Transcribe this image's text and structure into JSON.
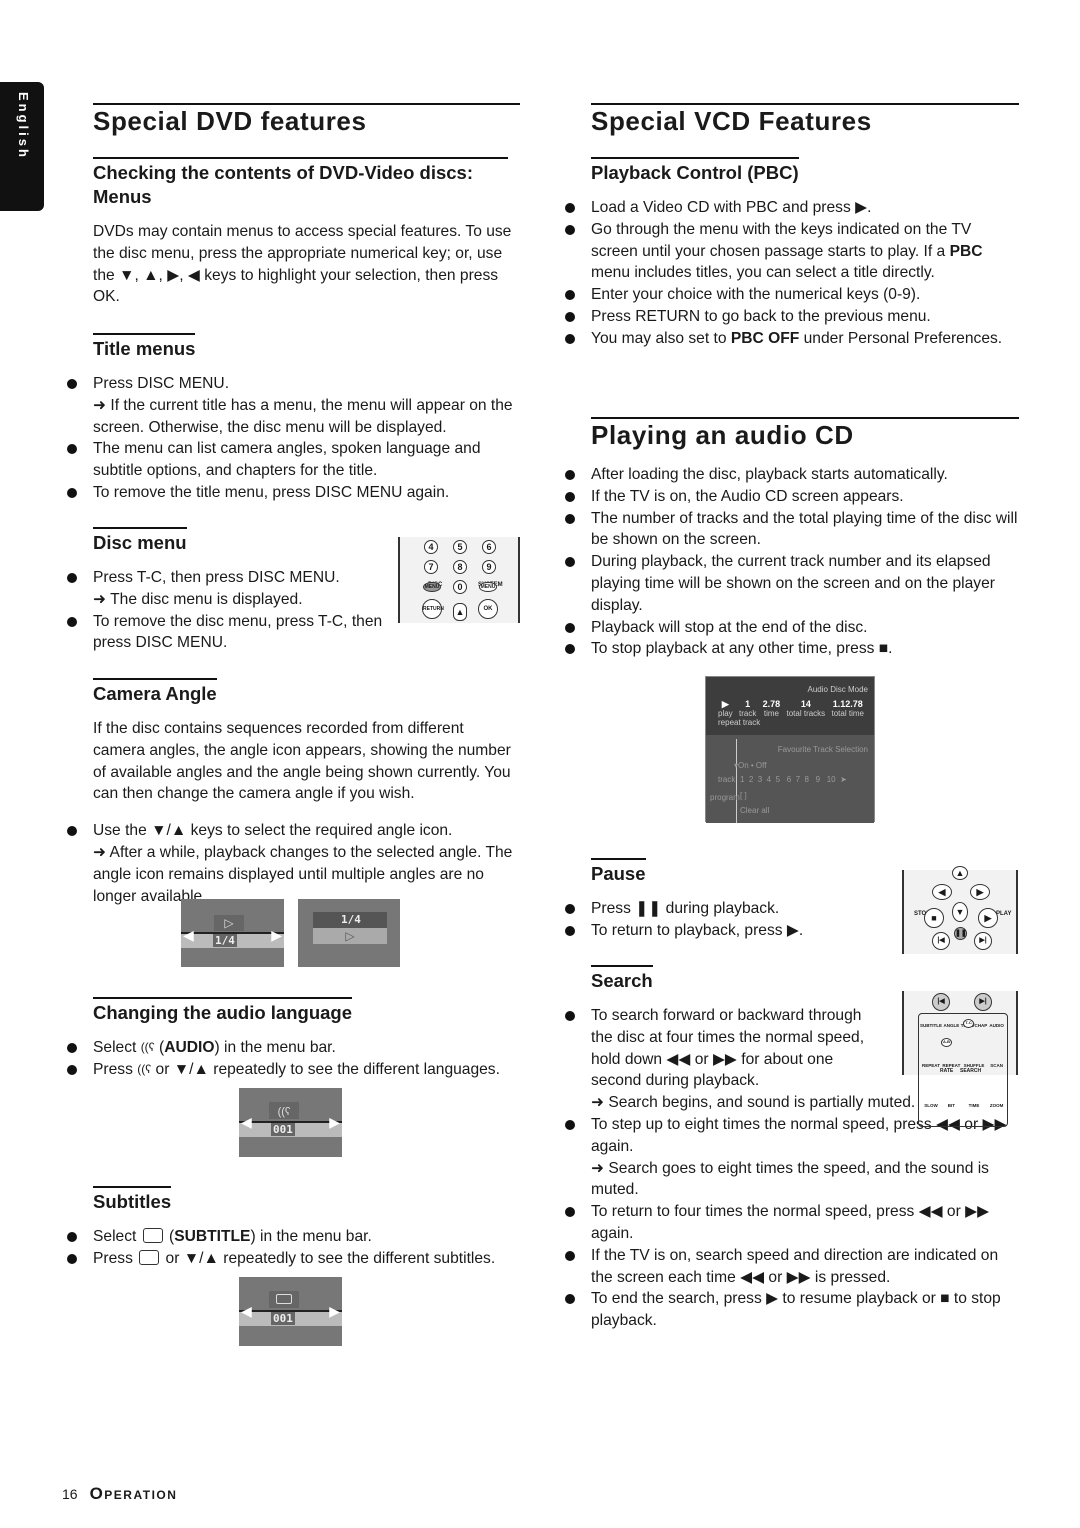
{
  "side_tab": "English",
  "footer": {
    "page_number": "16",
    "section": "Operation"
  },
  "left": [
    {
      "kind": "h1",
      "title": "Special DVD features"
    },
    {
      "kind": "h2",
      "title": "Checking the contents of DVD-Video discs: Menus",
      "full": true,
      "blocks": [
        {
          "type": "p",
          "text": "DVDs may contain menus to access special features. To use the disc menu, press the appropriate numerical key; or, use the ▼, ▲, ▶, ◀ keys to highlight your selection, then press OK."
        }
      ]
    },
    {
      "kind": "h2",
      "title": "Title menus",
      "blocks": [
        {
          "type": "bullet",
          "text": "Press DISC MENU."
        },
        {
          "type": "note",
          "text": "➜ If the current title has a menu, the menu will appear on the screen. Otherwise, the disc menu will be displayed."
        },
        {
          "type": "bullet",
          "text": "The menu can list camera angles, spoken language and subtitle options, and chapters for the title."
        },
        {
          "type": "bullet",
          "text": "To remove the title menu, press DISC MENU again."
        }
      ]
    },
    {
      "kind": "h2",
      "title": "Disc menu",
      "blocks": [
        {
          "type": "bullet",
          "text": "Press T-C, then press DISC MENU."
        },
        {
          "type": "note",
          "text": "➜ The disc menu is displayed."
        },
        {
          "type": "bullet",
          "text": "To remove the disc menu, press T-C, then press DISC MENU."
        }
      ]
    },
    {
      "kind": "h2",
      "title": "Camera Angle",
      "blocks": [
        {
          "type": "p",
          "text": "If the disc contains sequences recorded from different camera angles, the angle icon appears, showing the number of available angles and the angle being shown currently. You can then change the camera angle if you wish."
        },
        {
          "type": "bullet",
          "text": "Use the ▼/▲ keys to select the required angle icon."
        },
        {
          "type": "note",
          "text": "➜ After a while, playback changes to the selected angle. The angle  icon remains displayed until multiple angles are no longer available."
        }
      ]
    },
    {
      "kind": "h2",
      "title": "Changing the audio language",
      "blocks": [
        {
          "type": "bullet",
          "text": [
            {
              "t": "Select "
            },
            {
              "icon": "audio"
            },
            {
              "t": " ("
            },
            {
              "b": "AUDIO"
            },
            {
              "t": ") in the menu bar."
            }
          ]
        },
        {
          "type": "bullet",
          "text": [
            {
              "t": "Press "
            },
            {
              "icon": "audio"
            },
            {
              "t": " or ▼/▲ repeatedly to see the different languages."
            }
          ]
        }
      ]
    },
    {
      "kind": "h2",
      "title": "Subtitles",
      "blocks": [
        {
          "type": "bullet",
          "text": [
            {
              "t": "Select "
            },
            {
              "icon": "subtitle"
            },
            {
              "t": " ("
            },
            {
              "b": "SUBTITLE"
            },
            {
              "t": ") in the menu bar."
            }
          ]
        },
        {
          "type": "bullet",
          "text": [
            {
              "t": "Press "
            },
            {
              "icon": "subtitle"
            },
            {
              "t": " or ▼/▲ repeatedly to see the different subtitles."
            }
          ]
        }
      ]
    }
  ],
  "right": [
    {
      "kind": "h1",
      "title": "Special VCD Features"
    },
    {
      "kind": "h2",
      "title": "Playback Control (PBC)",
      "blocks": [
        {
          "type": "bullet",
          "text": "Load a Video CD with PBC and press ▶."
        },
        {
          "type": "bullet",
          "text": [
            {
              "t": "Go through the menu with the keys indicated on the TV screen until your chosen passage starts to play. If a "
            },
            {
              "b": "PBC"
            },
            {
              "t": " menu includes titles, you can select a title directly."
            }
          ]
        },
        {
          "type": "bullet",
          "text": "Enter your choice with the numerical keys (0-9)."
        },
        {
          "type": "bullet",
          "text": "Press RETURN to go back to the previous menu."
        },
        {
          "type": "bullet",
          "text": [
            {
              "t": "You may also set to "
            },
            {
              "b": "PBC OFF"
            },
            {
              "t": " under Personal Preferences."
            }
          ]
        }
      ]
    },
    {
      "kind": "h1",
      "title": "Playing an audio CD"
    },
    {
      "kind": "list",
      "blocks": [
        {
          "type": "bullet",
          "text": "After loading the disc, playback starts automatically."
        },
        {
          "type": "bullet",
          "text": "If the TV is on, the Audio CD screen appears."
        },
        {
          "type": "bullet",
          "text": "The number of tracks and the total playing time of the disc will be shown on the screen."
        },
        {
          "type": "bullet",
          "text": "During playback, the current track number and its elapsed playing time will be shown on the screen and on the player display."
        },
        {
          "type": "bullet",
          "text": "Playback will stop at the end of the disc."
        },
        {
          "type": "bullet",
          "text": "To stop playback at any other time, press ■."
        }
      ]
    },
    {
      "kind": "h2",
      "title": "Pause",
      "blocks": [
        {
          "type": "bullet",
          "text": "Press ❚❚ during playback."
        },
        {
          "type": "bullet",
          "text": "To return to playback, press ▶."
        }
      ]
    },
    {
      "kind": "h2",
      "title": "Search",
      "blocks": [
        {
          "type": "bullet",
          "text": "To search forward or backward through the disc at four times the normal speed, hold down ◀◀ or ▶▶ for about one second during playback."
        },
        {
          "type": "note",
          "text": "➜ Search begins, and sound is partially muted."
        },
        {
          "type": "bullet",
          "text": "To step up to eight times the normal speed, press ◀◀ or ▶▶ again."
        },
        {
          "type": "note",
          "text": "➜ Search goes to eight times the speed, and the sound is muted."
        },
        {
          "type": "bullet",
          "text": "To return to four times the normal speed, press ◀◀ or ▶▶ again."
        },
        {
          "type": "bullet",
          "text": "If the TV is on, search speed and direction are indicated on the screen each time ◀◀ or ▶▶ is pressed."
        },
        {
          "type": "bullet",
          "text": "To end the search, press ▶ to resume playback or ■ to stop playback."
        }
      ]
    }
  ],
  "audio_cd_screen": {
    "mode": "Audio Disc Mode",
    "fields": [
      {
        "value": "▶",
        "label": "play"
      },
      {
        "value": "1",
        "label": "track"
      },
      {
        "value": "2.78",
        "label": "time"
      },
      {
        "value": "14",
        "label": "total tracks"
      },
      {
        "value": "1.12.78",
        "label": "total time"
      }
    ],
    "repeat": "repeat track",
    "fts_title": "Favourite Track Selection",
    "on_off": "▾On • Off",
    "track_label": "track",
    "tracks": "1  2  3  4  5   6  7  8   9   10  ➤",
    "program_label": "program",
    "program_value": "[ ]",
    "clear_all": "Clear all"
  },
  "osd": {
    "angle_value": "1/4",
    "audio_value": "001",
    "subtitle_value": "001"
  },
  "remotes": {
    "disc": {
      "keys": [
        "4",
        "5",
        "6",
        "7",
        "8",
        "9",
        "0"
      ],
      "disc": "DISC",
      "system": "SYSTEM",
      "menu": "MENU",
      "return": "RETURN",
      "ok": "OK"
    },
    "pause": {
      "stop": "STOP",
      "play": "PLAY"
    },
    "search": {
      "row1": [
        "SUBTITLE",
        "ANGLE",
        "TITLE/CHAP",
        "AUDIO"
      ],
      "row2": [
        "REPEAT",
        "REPEAT",
        "SHUFFLE",
        "SCAN"
      ],
      "row3": [
        "SLOW",
        "BIT",
        "TIME",
        "ZOOM"
      ],
      "ab": "A-B",
      "tc": "T-C",
      "rate": "RATE",
      "search": "SEARCH"
    }
  }
}
